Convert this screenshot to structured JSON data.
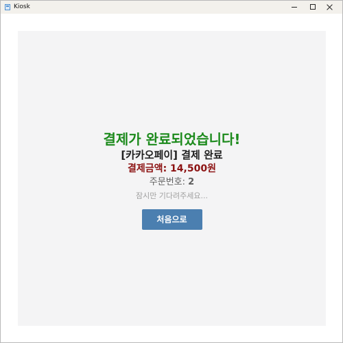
{
  "window": {
    "title": "Kiosk"
  },
  "icons": {
    "app": "app-window-icon",
    "minimize": "minimize-icon",
    "maximize": "maximize-icon",
    "close": "close-icon"
  },
  "payment_complete": {
    "title": "결제가 완료되었습니다!",
    "status": "[카카오페이] 결제 완료",
    "amount_label": "결제금액:",
    "amount_value": "14,500원",
    "order_label": "주문번호:",
    "order_number": "2",
    "wait_message": "잠시만 기다려주세요...",
    "home_button": "처음으로"
  },
  "colors": {
    "success": "#1c8a1c",
    "amount": "#8c1212",
    "button": "#4b7fb0",
    "panel": "#f4f4f5"
  }
}
